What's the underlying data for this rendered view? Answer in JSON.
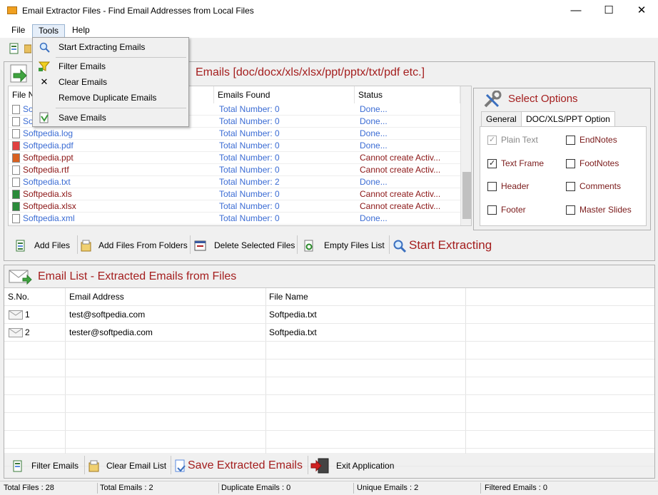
{
  "window": {
    "title": "Email Extractor Files -  Find Email Addresses from Local Files",
    "controls": [
      "minimize-icon",
      "maximize-icon",
      "close-icon"
    ]
  },
  "menubar": {
    "items": [
      {
        "label": "File"
      },
      {
        "label": "Tools"
      },
      {
        "label": "Help"
      }
    ]
  },
  "dropdown": {
    "items": [
      {
        "label": "Start Extracting Emails",
        "icon": "magnifier-icon"
      },
      {
        "label": "Filter Emails",
        "icon": "funnel-icon"
      },
      {
        "label": "Clear Emails",
        "icon": "x-icon"
      },
      {
        "label": "Remove Duplicate Emails",
        "icon": ""
      },
      {
        "label": "Save Emails",
        "icon": "save-icon"
      }
    ]
  },
  "files_panel": {
    "header": "Emails [doc/docx/xls/xlsx/ppt/pptx/txt/pdf etc.]",
    "columns": [
      "File N",
      "Emails Found",
      "Status"
    ],
    "rows": [
      {
        "name": "Sof",
        "found": "Total Number: 0",
        "status": "Done...",
        "color": "#3b6cd4",
        "icon": "doc-icon"
      },
      {
        "name": "Sof",
        "found": "Total Number: 0",
        "status": "Done...",
        "color": "#3b6cd4",
        "icon": "doc-icon"
      },
      {
        "name": "Softpedia.log",
        "found": "Total Number: 0",
        "status": "Done...",
        "color": "#3b6cd4",
        "icon": "doc-icon"
      },
      {
        "name": "Softpedia.pdf",
        "found": "Total Number: 0",
        "status": "Done...",
        "color": "#3b6cd4",
        "icon": "pdf-icon"
      },
      {
        "name": "Softpedia.ppt",
        "found": "Total Number: 0",
        "status": "Cannot create Activ...",
        "color": "#8b1515",
        "icon": "ppt-icon"
      },
      {
        "name": "Softpedia.rtf",
        "found": "Total Number: 0",
        "status": "Cannot create Activ...",
        "color": "#8b1515",
        "icon": "doc-icon"
      },
      {
        "name": "Softpedia.txt",
        "found": "Total Number: 2",
        "status": "Done...",
        "color": "#3b6cd4",
        "icon": "doc-icon"
      },
      {
        "name": "Softpedia.xls",
        "found": "Total Number: 0",
        "status": "Cannot create Activ...",
        "color": "#8b1515",
        "icon": "xls-icon"
      },
      {
        "name": "Softpedia.xlsx",
        "found": "Total Number: 0",
        "status": "Cannot create Activ...",
        "color": "#8b1515",
        "icon": "xls-icon"
      },
      {
        "name": "Softpedia.xml",
        "found": "Total Number: 0",
        "status": "Done...",
        "color": "#3b6cd4",
        "icon": "doc-icon"
      }
    ]
  },
  "options": {
    "title": "Select Options",
    "tabs": [
      "General",
      "DOC/XLS/PPT Option"
    ],
    "checks": [
      {
        "label": "Plain Text",
        "checked": true,
        "disabled": true
      },
      {
        "label": "EndNotes",
        "checked": false,
        "disabled": false
      },
      {
        "label": "Text Frame",
        "checked": true,
        "disabled": false
      },
      {
        "label": "FootNotes",
        "checked": false,
        "disabled": false
      },
      {
        "label": "Header",
        "checked": false,
        "disabled": false
      },
      {
        "label": "Comments",
        "checked": false,
        "disabled": false
      },
      {
        "label": "Footer",
        "checked": false,
        "disabled": false
      },
      {
        "label": "Master Slides",
        "checked": false,
        "disabled": false
      }
    ]
  },
  "actions": {
    "add_files": "Add Files",
    "add_folders": "Add Files From Folders",
    "delete_selected": "Delete Selected Files",
    "empty_list": "Empty Files List",
    "start": "Start Extracting"
  },
  "email_panel": {
    "title": "Email List - Extracted Emails from Files",
    "columns": [
      "S.No.",
      "Email Address",
      "File Name"
    ],
    "rows": [
      {
        "sno": "1",
        "email": "test@softpedia.com",
        "file": "Softpedia.txt"
      },
      {
        "sno": "2",
        "email": "tester@softpedia.com",
        "file": "Softpedia.txt"
      }
    ]
  },
  "bottom_actions": {
    "filter": "Filter Emails",
    "clear": "Clear Email List",
    "save": "Save Extracted Emails",
    "exit": "Exit Application"
  },
  "statusbar": {
    "total_files": "Total Files :  28",
    "total_emails": "Total Emails :   2",
    "duplicate": "Duplicate Emails :   0",
    "unique": "Unique Emails :   2",
    "filtered": "Filtered Emails :  0"
  },
  "colors": {
    "accent_red": "#a41e1e",
    "link_blue": "#3b6cd4",
    "error_red": "#8b1515"
  }
}
